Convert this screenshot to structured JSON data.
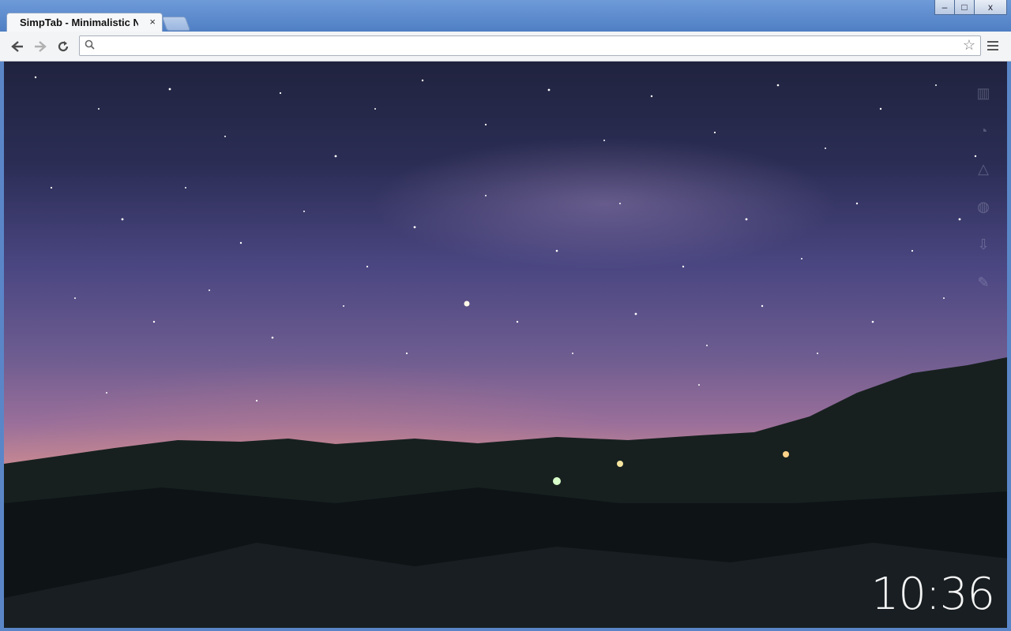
{
  "browser": {
    "tab_title": "SimpTab - Minimalistic Ne",
    "tab_close": "×",
    "window_controls": {
      "minimize": "–",
      "maximize": "□",
      "close": "x"
    },
    "toolbar": {
      "back_icon": "back-arrow-icon",
      "forward_icon": "forward-arrow-icon",
      "reload_icon": "reload-icon",
      "omnibox_value": "",
      "search_icon": "search-icon",
      "star_icon": "star-icon",
      "menu_icon": "hamburger-menu-icon"
    }
  },
  "page": {
    "clock": "10:36",
    "side_icons": [
      "bookmark-icon",
      "history-icon",
      "apps-icon",
      "bulb-icon",
      "download-icon",
      "wrench-icon"
    ]
  },
  "colors": {
    "titlebar": "#5f8ed0",
    "toolbar": "#f3f4f6",
    "sky_top": "#20233e",
    "horizon": "#f09a56"
  }
}
